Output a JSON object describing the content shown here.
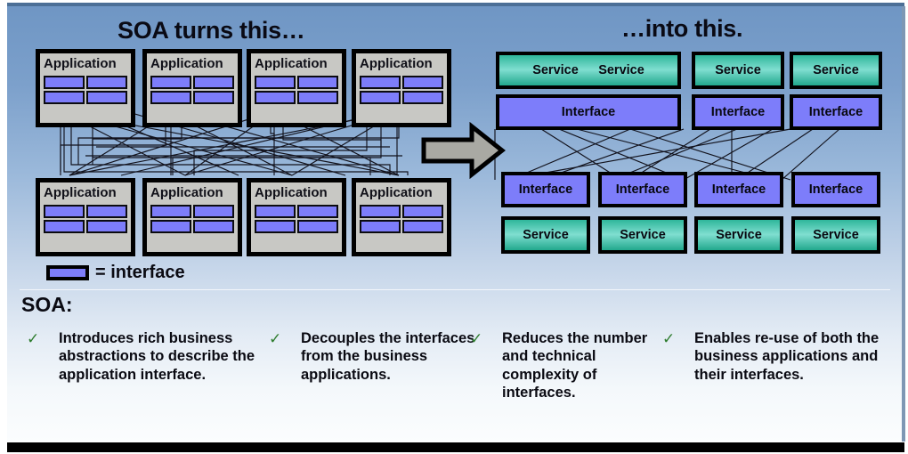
{
  "slide": {
    "left_panel_title": "SOA turns this…",
    "right_panel_title": "…into this.",
    "section_heading": "SOA:",
    "legend": {
      "symbol_name": "interface-swatch",
      "text": "= interface"
    }
  },
  "left_diagram": {
    "app_label": "Application",
    "top_row_apps": [
      {
        "label": "Application"
      },
      {
        "label": "Application"
      },
      {
        "label": "Application"
      },
      {
        "label": "Application"
      }
    ],
    "bottom_row_apps": [
      {
        "label": "Application"
      },
      {
        "label": "Application"
      },
      {
        "label": "Application"
      },
      {
        "label": "Application"
      }
    ],
    "interfaces_per_app": 4
  },
  "right_diagram": {
    "top_services": [
      {
        "label": "Service",
        "label2": "Service",
        "wide": true
      },
      {
        "label": "Service",
        "wide": false
      },
      {
        "label": "Service",
        "wide": false
      }
    ],
    "top_interfaces": [
      {
        "label": "Interface",
        "wide": true
      },
      {
        "label": "Interface",
        "wide": false
      },
      {
        "label": "Interface",
        "wide": false
      }
    ],
    "bottom_interfaces": [
      {
        "label": "Interface"
      },
      {
        "label": "Interface"
      },
      {
        "label": "Interface"
      },
      {
        "label": "Interface"
      }
    ],
    "bottom_services": [
      {
        "label": "Service"
      },
      {
        "label": "Service"
      },
      {
        "label": "Service"
      },
      {
        "label": "Service"
      }
    ]
  },
  "transform_arrow": {
    "name": "right-arrow",
    "direction": "right"
  },
  "bullets": [
    {
      "check": "✓",
      "text": "Introduces rich business abstractions to describe the application interface."
    },
    {
      "check": "✓",
      "text": "Decouples the interfaces from the business applications."
    },
    {
      "check": "✓",
      "text": "Reduces the number and technical complexity of interfaces."
    },
    {
      "check": "✓",
      "text": "Enables re-use of both the business applications and their interfaces."
    }
  ],
  "colors": {
    "background_top": "#6f96c4",
    "background_bottom": "#fbfdfe",
    "interface_blue": "#7d7dfa",
    "service_teal": "#2fb79b",
    "application_gray": "#c8c8c4",
    "arrow_gray": "#a9a9a3",
    "check_green": "#2f7d2f",
    "outline_black": "#000000"
  }
}
